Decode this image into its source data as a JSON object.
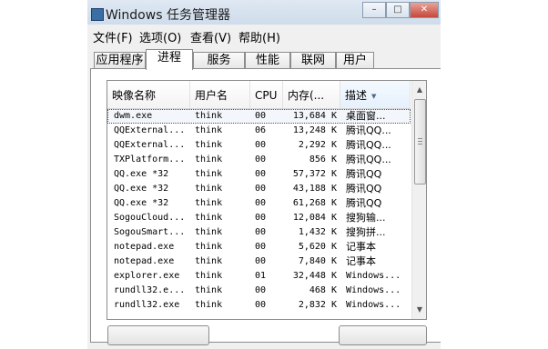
{
  "window": {
    "title": "Windows 任务管理器"
  },
  "menu": [
    "文件(F)",
    "选项(O)",
    "查看(V)",
    "帮助(H)"
  ],
  "tabs": [
    {
      "label": "应用程序",
      "active": false
    },
    {
      "label": "进程",
      "active": true
    },
    {
      "label": "服务",
      "active": false
    },
    {
      "label": "性能",
      "active": false
    },
    {
      "label": "联网",
      "active": false
    },
    {
      "label": "用户",
      "active": false
    }
  ],
  "process_table": {
    "columns": [
      "映像名称",
      "用户名",
      "CPU",
      "内存(...",
      "描述"
    ],
    "sorted_column": "描述",
    "rows": [
      {
        "name": "dwm.exe",
        "user": "think",
        "cpu": "00",
        "mem": "13,684 K",
        "desc": "桌面窗..."
      },
      {
        "name": "QQExternal...",
        "user": "think",
        "cpu": "06",
        "mem": "13,248 K",
        "desc": "腾讯QQ..."
      },
      {
        "name": "QQExternal...",
        "user": "think",
        "cpu": "00",
        "mem": "2,292 K",
        "desc": "腾讯QQ..."
      },
      {
        "name": "TXPlatform...",
        "user": "think",
        "cpu": "00",
        "mem": "856 K",
        "desc": "腾讯QQ..."
      },
      {
        "name": "QQ.exe *32",
        "user": "think",
        "cpu": "00",
        "mem": "57,372 K",
        "desc": "腾讯QQ"
      },
      {
        "name": "QQ.exe *32",
        "user": "think",
        "cpu": "00",
        "mem": "43,188 K",
        "desc": "腾讯QQ"
      },
      {
        "name": "QQ.exe *32",
        "user": "think",
        "cpu": "00",
        "mem": "61,268 K",
        "desc": "腾讯QQ"
      },
      {
        "name": "SogouCloud...",
        "user": "think",
        "cpu": "00",
        "mem": "12,084 K",
        "desc": "搜狗输..."
      },
      {
        "name": "SogouSmart...",
        "user": "think",
        "cpu": "00",
        "mem": "1,432 K",
        "desc": "搜狗拼..."
      },
      {
        "name": "notepad.exe",
        "user": "think",
        "cpu": "00",
        "mem": "5,620 K",
        "desc": "记事本"
      },
      {
        "name": "notepad.exe",
        "user": "think",
        "cpu": "00",
        "mem": "7,840 K",
        "desc": "记事本"
      },
      {
        "name": "explorer.exe",
        "user": "think",
        "cpu": "01",
        "mem": "32,448 K",
        "desc": "Windows..."
      },
      {
        "name": "rundll32.e...",
        "user": "think",
        "cpu": "00",
        "mem": "468 K",
        "desc": "Windows..."
      },
      {
        "name": "rundll32.exe",
        "user": "think",
        "cpu": "00",
        "mem": "2,832 K",
        "desc": "Windows..."
      }
    ],
    "selected_index": 0
  }
}
